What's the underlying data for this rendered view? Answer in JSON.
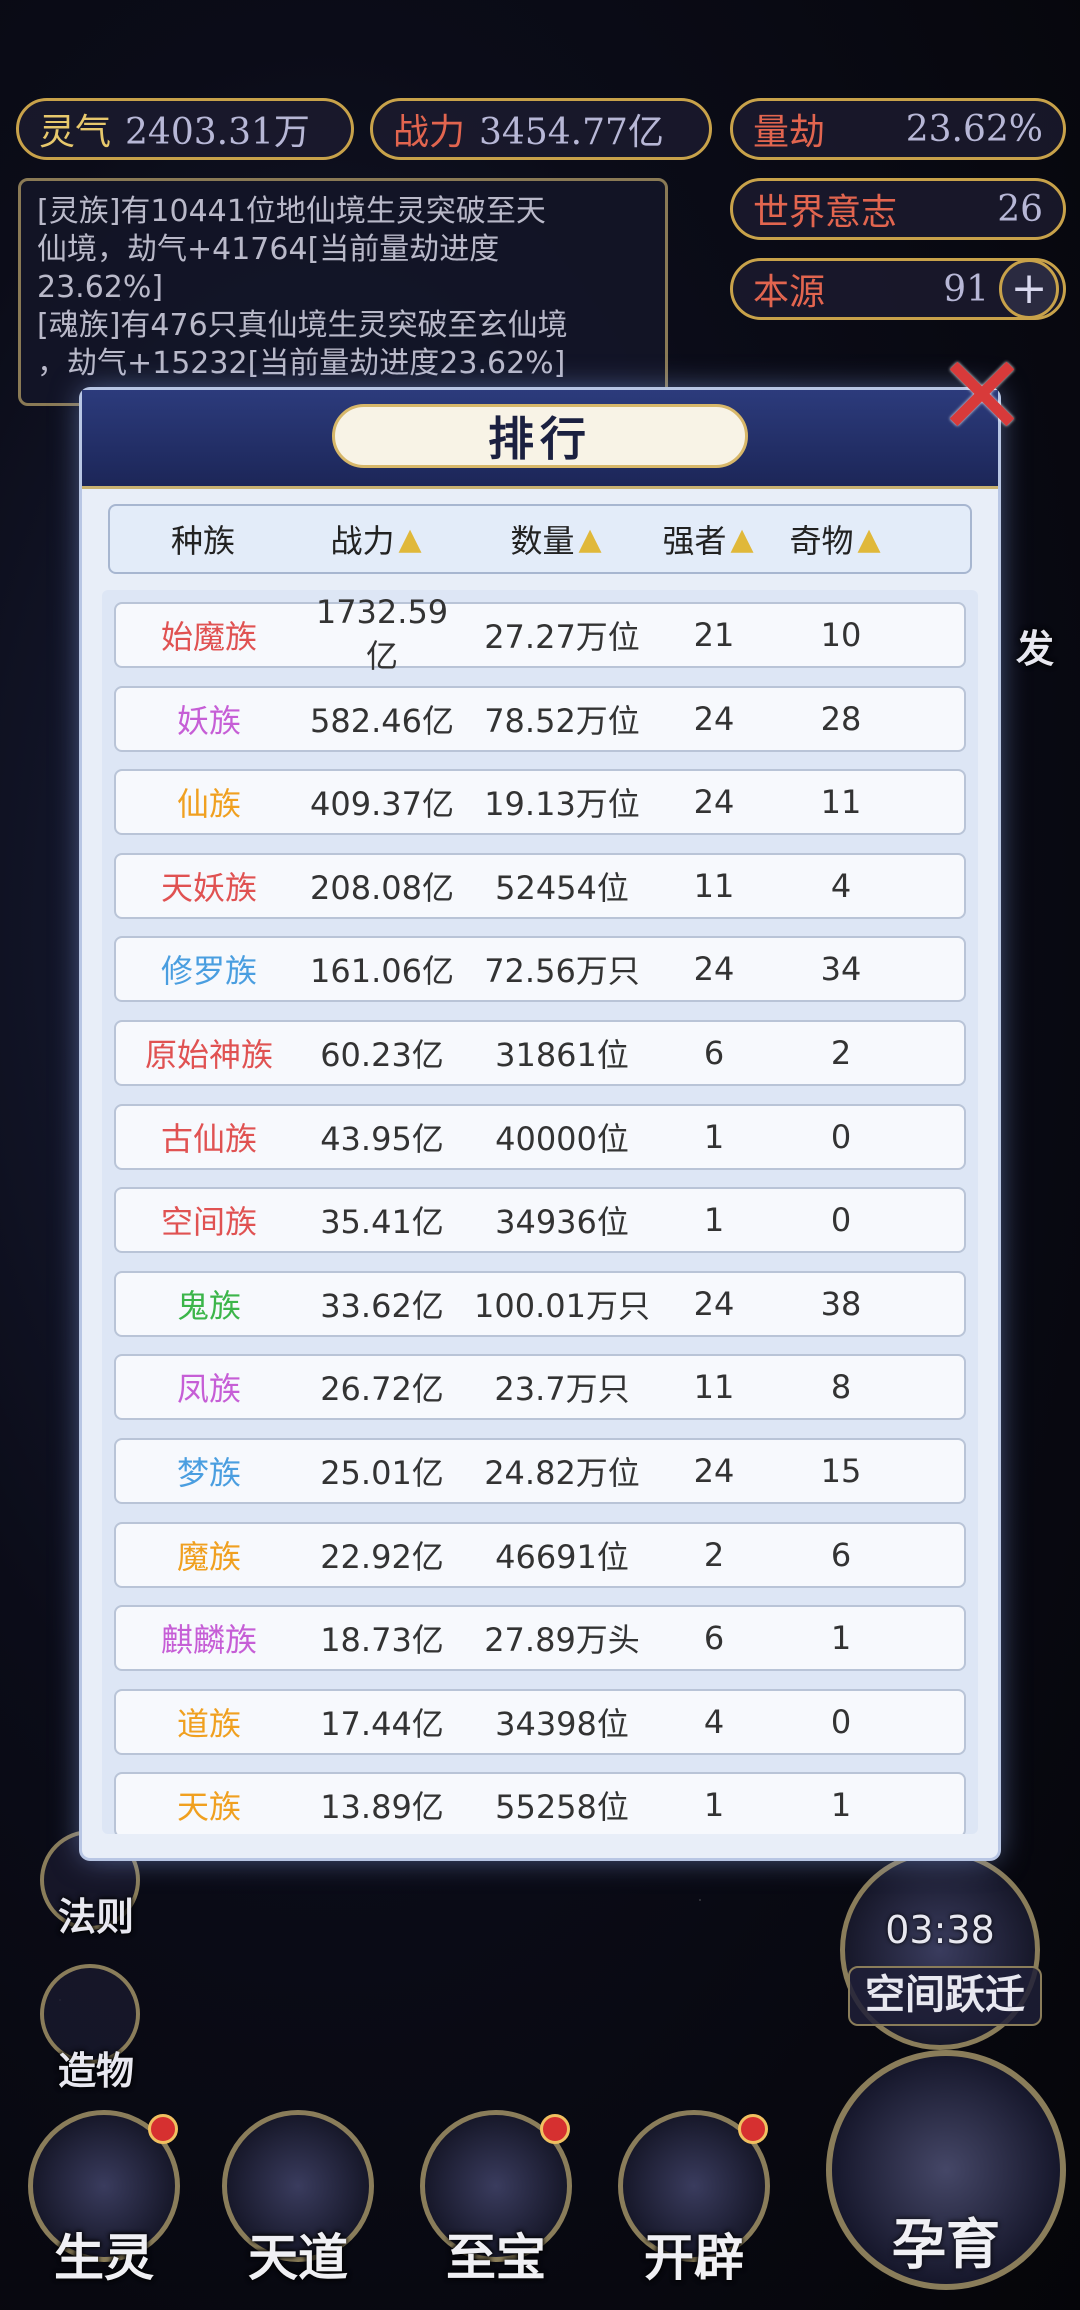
{
  "top_stats": {
    "lingqi": {
      "label": "灵气",
      "value": "2403.31万"
    },
    "zhanli": {
      "label": "战力",
      "value": "3454.77亿"
    },
    "liangjie": {
      "label": "量劫",
      "value": "23.62%"
    },
    "shijie": {
      "label": "世界意志",
      "value": "26"
    },
    "benyuan": {
      "label": "本源",
      "value": "91"
    }
  },
  "log": {
    "l1": "[灵族]有10441位地仙境生灵突破至天",
    "l2": "仙境，劫气+41764[当前量劫进度",
    "l3": "23.62%]",
    "l4": "[魂族]有476只真仙境生灵突破至玄仙境",
    "l5": "，劫气+15232[当前量劫进度23.62%]"
  },
  "modal": {
    "title": "排行",
    "close": "✕",
    "headers": {
      "race": "种族",
      "power": "战力",
      "count": "数量",
      "strong": "强者",
      "treasure": "奇物"
    },
    "sort_icon": "arrow-up-icon"
  },
  "colors": {
    "red": "#e05252",
    "purple": "#c65ed6",
    "orange": "#f0a020",
    "blue": "#4a9ee0",
    "green": "#3cb54a"
  },
  "rows": [
    {
      "race": "始魔族",
      "power": "1732.59亿",
      "count": "27.27万位",
      "strong": "21",
      "treasure": "10",
      "color": "#e05252"
    },
    {
      "race": "妖族",
      "power": "582.46亿",
      "count": "78.52万位",
      "strong": "24",
      "treasure": "28",
      "color": "#c65ed6"
    },
    {
      "race": "仙族",
      "power": "409.37亿",
      "count": "19.13万位",
      "strong": "24",
      "treasure": "11",
      "color": "#f0a020"
    },
    {
      "race": "天妖族",
      "power": "208.08亿",
      "count": "52454位",
      "strong": "11",
      "treasure": "4",
      "color": "#e05252"
    },
    {
      "race": "修罗族",
      "power": "161.06亿",
      "count": "72.56万只",
      "strong": "24",
      "treasure": "34",
      "color": "#4a9ee0"
    },
    {
      "race": "原始神族",
      "power": "60.23亿",
      "count": "31861位",
      "strong": "6",
      "treasure": "2",
      "color": "#e05252"
    },
    {
      "race": "古仙族",
      "power": "43.95亿",
      "count": "40000位",
      "strong": "1",
      "treasure": "0",
      "color": "#e05252"
    },
    {
      "race": "空间族",
      "power": "35.41亿",
      "count": "34936位",
      "strong": "1",
      "treasure": "0",
      "color": "#e05252"
    },
    {
      "race": "鬼族",
      "power": "33.62亿",
      "count": "100.01万只",
      "strong": "24",
      "treasure": "38",
      "color": "#3cb54a"
    },
    {
      "race": "凤族",
      "power": "26.72亿",
      "count": "23.7万只",
      "strong": "11",
      "treasure": "8",
      "color": "#c65ed6"
    },
    {
      "race": "梦族",
      "power": "25.01亿",
      "count": "24.82万位",
      "strong": "24",
      "treasure": "15",
      "color": "#4a9ee0"
    },
    {
      "race": "魔族",
      "power": "22.92亿",
      "count": "46691位",
      "strong": "2",
      "treasure": "6",
      "color": "#f0a020"
    },
    {
      "race": "麒麟族",
      "power": "18.73亿",
      "count": "27.89万头",
      "strong": "6",
      "treasure": "1",
      "color": "#c65ed6"
    },
    {
      "race": "道族",
      "power": "17.44亿",
      "count": "34398位",
      "strong": "4",
      "treasure": "0",
      "color": "#f0a020"
    },
    {
      "race": "天族",
      "power": "13.89亿",
      "count": "55258位",
      "strong": "1",
      "treasure": "1",
      "color": "#f0a020"
    }
  ],
  "side": {
    "fa_ze": "法则",
    "zao_wu": "造物",
    "bao_fa": "发"
  },
  "timer": {
    "time": "03:38",
    "action": "空间跃迁"
  },
  "bottom_nav": {
    "sheng_ling": "生灵",
    "tian_dao": "天道",
    "zhi_bao": "至宝",
    "kai_pi": "开辟",
    "yun_yu": "孕育"
  }
}
